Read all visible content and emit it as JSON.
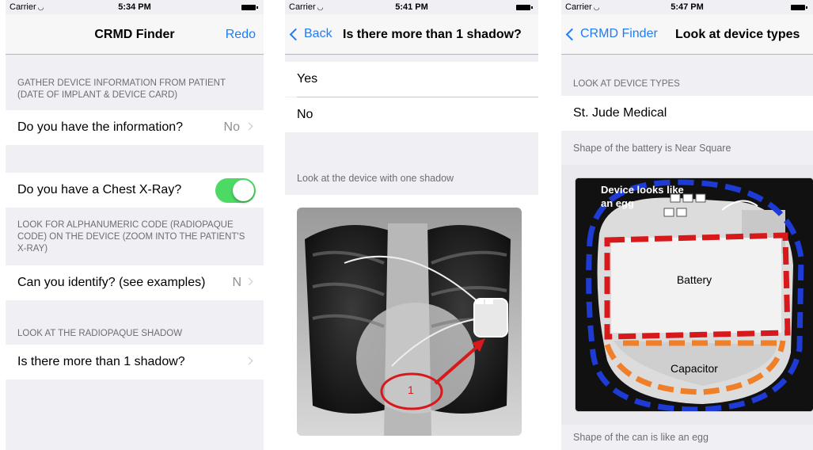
{
  "status": {
    "carrier": "Carrier"
  },
  "screens": [
    {
      "time": "5:34 PM",
      "nav": {
        "title": "CRMD Finder",
        "right": "Redo"
      },
      "sections": [
        {
          "header": "GATHER DEVICE INFORMATION FROM PATIENT (DATE OF IMPLANT & DEVICE CARD)"
        },
        {
          "header": "LOOK FOR ALPHANUMERIC CODE (RADIOPAQUE CODE) ON THE DEVICE (ZOOM INTO THE PATIENT'S X-RAY)"
        },
        {
          "header": "LOOK AT THE RADIOPAQUE SHADOW"
        }
      ],
      "rows": [
        {
          "label": "Do you have the information?",
          "value": "No"
        },
        {
          "label": "Do you have a Chest X-Ray?",
          "toggle": true
        },
        {
          "label": "Can you identify? (see examples)",
          "value": "N"
        },
        {
          "label": "Is there more than 1 shadow?",
          "value": ""
        }
      ]
    },
    {
      "time": "5:41 PM",
      "nav": {
        "back": "Back",
        "title": "Is there more than 1 shadow?"
      },
      "options": [
        "Yes",
        "No"
      ],
      "footer": "Look at the device with one shadow",
      "image": {
        "annotation": "1"
      }
    },
    {
      "time": "5:47 PM",
      "nav": {
        "back": "CRMD Finder",
        "title": "Look at device types"
      },
      "section_header": "LOOK AT DEVICE TYPES",
      "row": "St. Jude Medical",
      "footer_top": "Shape of the battery is Near Square",
      "image": {
        "note": "Device looks like an egg",
        "battery": "Battery",
        "capacitor": "Capacitor"
      },
      "footer_bottom": "Shape of the can is like an egg"
    }
  ],
  "colors": {
    "accent": "#1f7cf5",
    "toggle_on": "#4cd964",
    "annotation_red": "#d7191c",
    "dash_blue": "#1f3bd6",
    "dash_orange": "#f07f2a"
  }
}
